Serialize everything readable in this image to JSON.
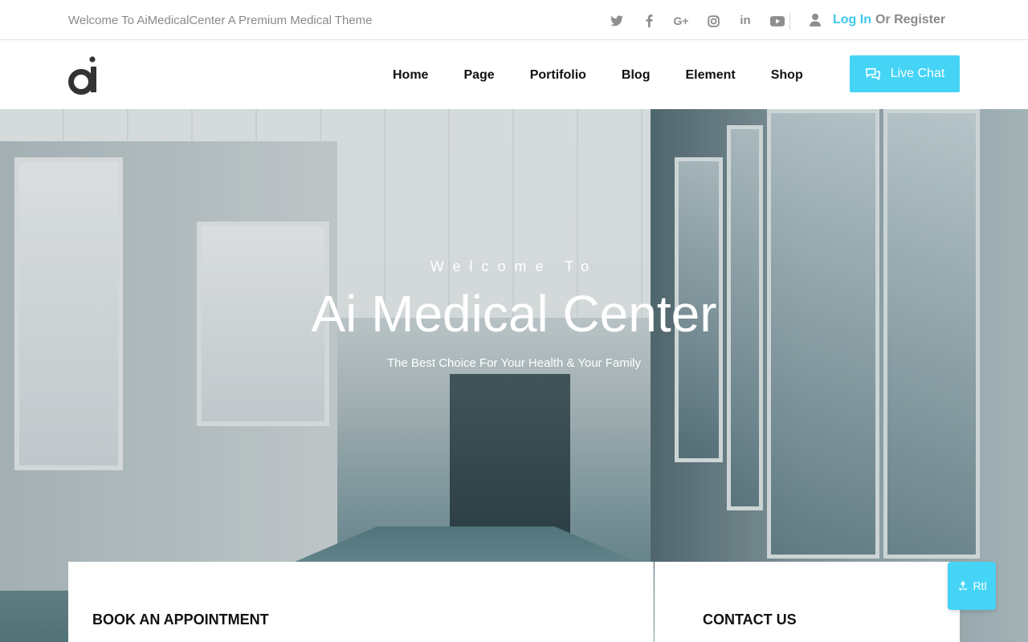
{
  "topbar": {
    "welcome_text": "Welcome To AiMedicalCenter A Premium Medical Theme",
    "social_icons": [
      "twitter-icon",
      "facebook-icon",
      "google-plus-icon",
      "instagram-icon",
      "linkedin-icon",
      "youtube-icon"
    ],
    "login_label": "Log In",
    "register_label": "Or Register"
  },
  "header": {
    "nav": [
      "Home",
      "Page",
      "Portifolio",
      "Blog",
      "Element",
      "Shop"
    ],
    "live_chat_label": "Live Chat"
  },
  "hero": {
    "eyebrow": "Welcome To",
    "title": "Ai Medical Center",
    "subtitle": "The Best Choice For Your Health & Your Family"
  },
  "cards": {
    "book_title": "BOOK AN APPOINTMENT",
    "contact_title": "CONTACT US"
  },
  "rtl_label": "Rtl",
  "colors": {
    "accent": "#45d4f5",
    "link": "#3ec7ea"
  }
}
